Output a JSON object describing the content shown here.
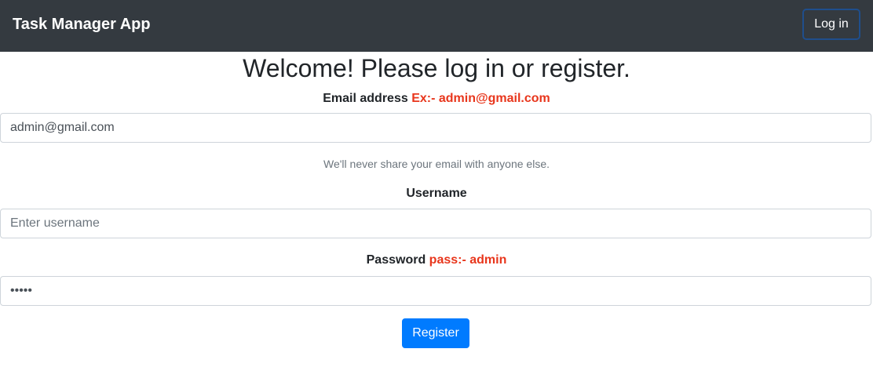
{
  "navbar": {
    "brand": "Task Manager App",
    "login_label": "Log in",
    "background_color": "#343a40"
  },
  "main": {
    "title": "Welcome! Please log in or register.",
    "email": {
      "label": "Email address",
      "hint": "Ex:- admin@gmail.com",
      "value": "admin@gmail.com",
      "help": "We'll never share your email with anyone else."
    },
    "username": {
      "label": "Username",
      "placeholder": "Enter username",
      "value": ""
    },
    "password": {
      "label": "Password",
      "hint": "pass:- admin",
      "value": "admin"
    },
    "register_label": "Register",
    "accent_color": "#007bff",
    "hint_color": "#e8361c"
  }
}
